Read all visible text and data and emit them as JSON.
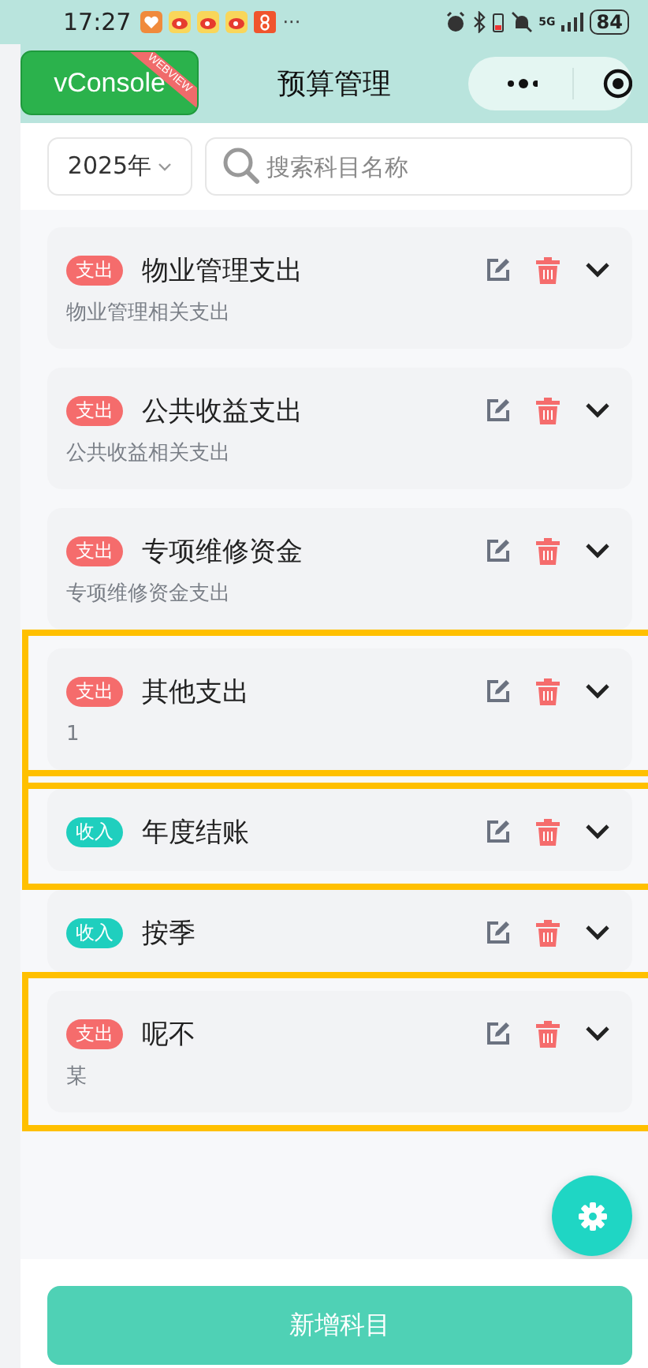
{
  "status_bar": {
    "time": "17:27",
    "more": "···",
    "network": "5G",
    "battery": "84"
  },
  "vconsole": {
    "label": "vConsole",
    "ribbon": "WEBVIEW"
  },
  "nav": {
    "title": "预算管理"
  },
  "filter": {
    "year": "2025年",
    "search": {
      "placeholder": "搜索科目名称"
    }
  },
  "items": [
    {
      "kind": "expense",
      "tag": "支出",
      "name": "物业管理支出",
      "description": "物业管理相关支出",
      "expanded": false,
      "highlighted": false
    },
    {
      "kind": "expense",
      "tag": "支出",
      "name": "公共收益支出",
      "description": "公共收益相关支出",
      "expanded": false,
      "highlighted": false
    },
    {
      "kind": "expense",
      "tag": "支出",
      "name": "专项维修资金",
      "description": "专项维修资金支出",
      "expanded": false,
      "highlighted": false
    },
    {
      "kind": "expense",
      "tag": "支出",
      "name": "其他支出",
      "description": "1",
      "expanded": false,
      "highlighted": true
    },
    {
      "kind": "income",
      "tag": "收入",
      "name": "年度结账",
      "expanded": false,
      "highlighted": true
    },
    {
      "kind": "income",
      "tag": "收入",
      "name": "按季",
      "expanded": false,
      "highlighted": false
    },
    {
      "kind": "expense",
      "tag": "支出",
      "name": "呢不",
      "description": "某",
      "expanded": false,
      "highlighted": true
    }
  ],
  "add_button": "新增科目"
}
